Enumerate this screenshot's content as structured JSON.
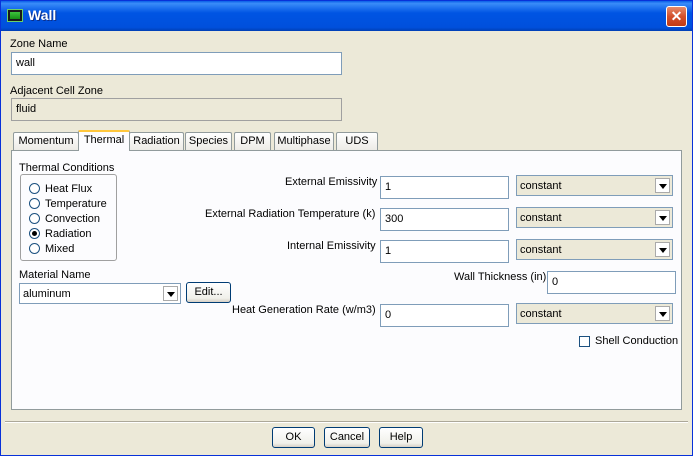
{
  "window": {
    "title": "Wall"
  },
  "zone_name": {
    "label": "Zone Name",
    "value": "wall"
  },
  "adjacent_cell_zone": {
    "label": "Adjacent Cell Zone",
    "value": "fluid"
  },
  "tabs": [
    {
      "label": "Momentum"
    },
    {
      "label": "Thermal"
    },
    {
      "label": "Radiation"
    },
    {
      "label": "Species"
    },
    {
      "label": "DPM"
    },
    {
      "label": "Multiphase"
    },
    {
      "label": "UDS"
    }
  ],
  "active_tab": "Thermal",
  "thermal": {
    "conditions_label": "Thermal Conditions",
    "conditions": [
      {
        "label": "Heat Flux",
        "selected": false
      },
      {
        "label": "Temperature",
        "selected": false
      },
      {
        "label": "Convection",
        "selected": false
      },
      {
        "label": "Radiation",
        "selected": true
      },
      {
        "label": "Mixed",
        "selected": false
      }
    ],
    "material_label": "Material Name",
    "material_value": "aluminum",
    "edit_label": "Edit...",
    "external_emissivity": {
      "label": "External Emissivity",
      "value": "1",
      "method": "constant"
    },
    "external_radiation_temperature": {
      "label": "External Radiation Temperature (k)",
      "value": "300",
      "method": "constant"
    },
    "internal_emissivity": {
      "label": "Internal Emissivity",
      "value": "1",
      "method": "constant"
    },
    "wall_thickness": {
      "label": "Wall Thickness (in)",
      "value": "0"
    },
    "heat_generation_rate": {
      "label": "Heat Generation Rate (w/m3)",
      "value": "0",
      "method": "constant"
    },
    "shell_conduction": {
      "label": "Shell Conduction",
      "checked": false
    }
  },
  "buttons": {
    "ok": "OK",
    "cancel": "Cancel",
    "help": "Help"
  }
}
